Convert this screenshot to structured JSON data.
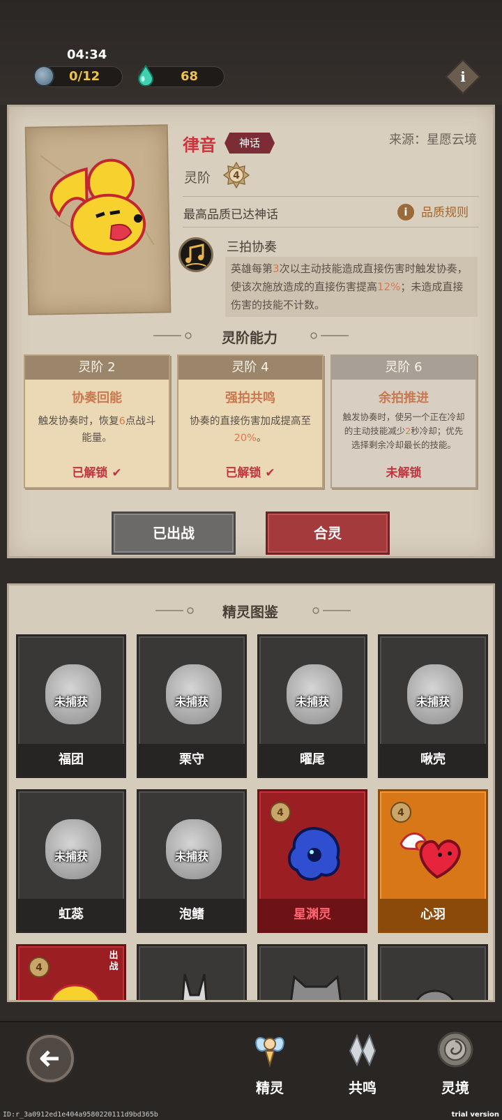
{
  "status": {
    "time": "04:34",
    "spirit_count": "0/12",
    "gem_count": "68"
  },
  "detail": {
    "name": "律音",
    "rarity": "神话",
    "source": "来源：星愿云境",
    "tier_label": "灵阶",
    "tier_value": "4",
    "quality_text": "最高品质已达神话",
    "quality_rule": "品质规则",
    "skill_name": "三拍协奏",
    "skill_desc_1": "英雄每第",
    "skill_desc_n": "3",
    "skill_desc_2": "次以主动技能造成直接伤害时触发协奏，使该次施放造成的直接伤害提高",
    "skill_desc_pct": "12%",
    "skill_desc_3": "；未造成直接伤害的技能不计数。"
  },
  "tier_section_title": "灵阶能力",
  "tiers": [
    {
      "header": "灵阶 2",
      "title": "协奏回能",
      "desc_a": "触发协奏时，恢复",
      "desc_num": "6",
      "desc_b": "点战斗能量。",
      "status": "已解锁"
    },
    {
      "header": "灵阶 4",
      "title": "强拍共鸣",
      "desc_a": "协奏的直接伤害加成提高至",
      "desc_num": "20%",
      "desc_b": "。",
      "status": "已解锁"
    },
    {
      "header": "灵阶 6",
      "title": "余拍推进",
      "desc_a": "触发协奏时，使另一个正在冷却的主动技能减少",
      "desc_num": "2",
      "desc_b": "秒冷却；优先选择剩余冷却最长的技能。",
      "status": "未解锁"
    }
  ],
  "actions": {
    "deploy": "已出战",
    "merge": "合灵"
  },
  "codex": {
    "title": "精灵图鉴",
    "uncaptured_label": "未捕获",
    "deployed_label": "出战",
    "cards": [
      {
        "name": "福团",
        "state": "uncaptured"
      },
      {
        "name": "栗守",
        "state": "uncaptured"
      },
      {
        "name": "曜尾",
        "state": "uncaptured"
      },
      {
        "name": "啾壳",
        "state": "uncaptured"
      },
      {
        "name": "虹蕊",
        "state": "uncaptured"
      },
      {
        "name": "泡鳍",
        "state": "uncaptured"
      },
      {
        "name": "星渊灵",
        "state": "red",
        "level": "4"
      },
      {
        "name": "心羽",
        "state": "orange",
        "level": "4"
      }
    ],
    "partial_row_level": "4"
  },
  "nav": {
    "tab_spirit": "精灵",
    "tab_resonance": "共鸣",
    "tab_realm": "灵境"
  },
  "footer": {
    "id": "ID:r_3a0912ed1e404a9580220111d9bd365b",
    "trial": "trial version"
  },
  "colors": {
    "accent_red": "#d2303d",
    "orange_text": "#c97850",
    "gold": "#f0c24a"
  }
}
